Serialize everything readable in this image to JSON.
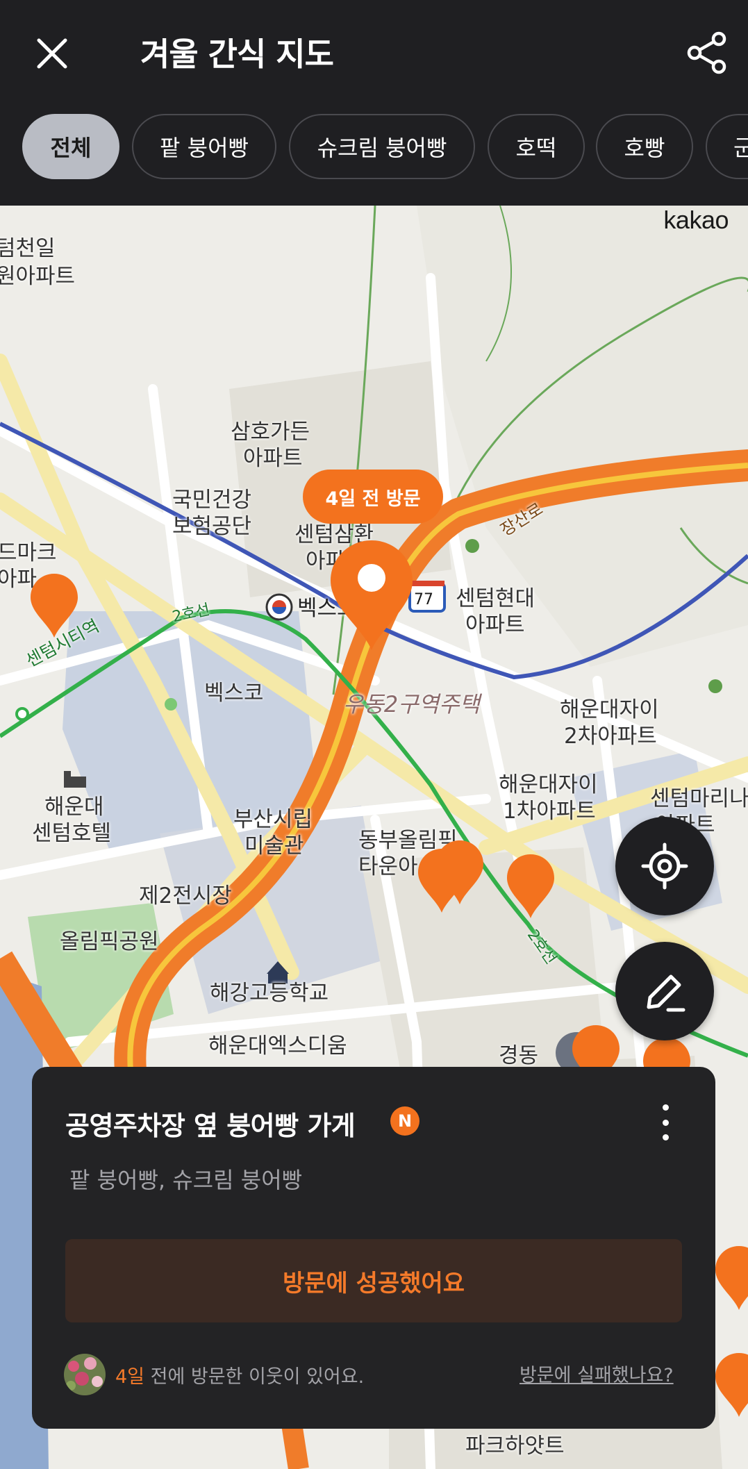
{
  "header": {
    "title": "겨울 간식 지도",
    "close_icon": "close-icon",
    "share_icon": "share-icon"
  },
  "filters": {
    "chips": [
      "전체",
      "팥 붕어빵",
      "슈크림 붕어빵",
      "호떡",
      "호빵",
      "군"
    ],
    "selected": "전체"
  },
  "map": {
    "provider": "kakao",
    "labels": {
      "l1": "텀천일",
      "l2": "원아파트",
      "l3": "삼호가든",
      "l4": "아파트",
      "l5": "국민건강",
      "l6": "보험공단",
      "l7": "센텀삼환",
      "l8": "아파",
      "l9": "센텀현대",
      "l10": "아파트",
      "l11": "드마크",
      "l12": "아파",
      "l13": "벡스코",
      "l14": "벡스코",
      "l15": "센텀시티역",
      "l16": "2호선",
      "l17": "장산로",
      "l18": "77",
      "l19": "우동2구역주택",
      "l20": "해운대자이",
      "l21": "2차아파트",
      "l22": "해운대자이",
      "l23": "1차아파트",
      "l24": "센텀마리나",
      "l25": "아파트",
      "l26": "해운대",
      "l27": "센텀호텔",
      "l28": "부산시립",
      "l29": "미술관",
      "l30": "동부올림픽",
      "l31": "타운아",
      "l32": "제2전시장",
      "l33": "올림픽공원",
      "l34": "해강고등학교",
      "l35": "해운대엑스디움",
      "l36": "2호선",
      "l37": "경동",
      "l38": "파크하얏트"
    },
    "visit_bubble": "4일 전 방문",
    "accent_color": "#f3721e"
  },
  "controls": {
    "locate_icon": "crosshair-icon",
    "write_icon": "pencil-icon"
  },
  "store_card": {
    "name": "공영주차장 옆 붕어빵 가게",
    "new_badge": "N",
    "menu": "팥 붕어빵, 슈크림 붕어빵",
    "success_button": "방문에 성공했어요",
    "neighbor_days": "4일",
    "neighbor_text": " 전에 방문한 이웃이 있어요.",
    "fail_link": "방문에 실패했나요?",
    "more_icon": "more-vertical-icon"
  }
}
